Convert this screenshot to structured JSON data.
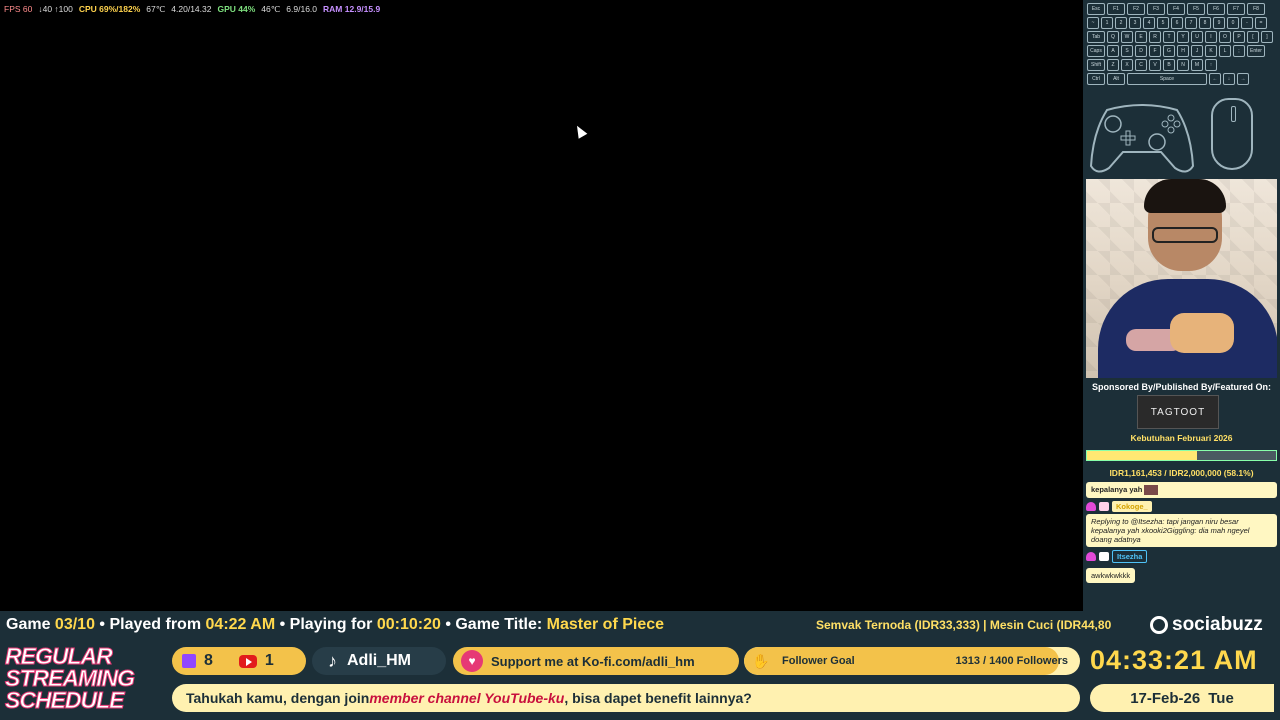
{
  "stats": {
    "fps": "FPS 60",
    "fps_range": "↓40 ↑100",
    "cpu": "CPU 69%/182%",
    "cpu_temp": "67℃",
    "cpu_clock": "4.20/14.32",
    "gpu": "GPU 44%",
    "gpu_temp": "46℃",
    "gpu_mem": "6.9/16.0",
    "ram": "RAM 12.9/15.9"
  },
  "sidebar": {
    "sponsor_title": "Sponsored By/Published By/Featured On:",
    "sponsor_logo": "TAGTOOT",
    "goal_title": "Kebutuhan Februari 2026",
    "goal_progress": 0.581,
    "goal_text": "IDR1,161,453 / IDR2,000,000 (58.1%)",
    "chat": [
      {
        "text": "kepalanya yah"
      },
      {
        "user": "Kokoge_",
        "user_color": "#ffd84d",
        "text": "Replying to @Itsezha: tapi jangan niru besar kepalanya yah xkooki2Giggling:  dia mah ngeyel doang adatnya"
      },
      {
        "user": "Itsezha",
        "user_color": "#4fc3f7",
        "text": "awkwkwkkk"
      }
    ]
  },
  "bottom": {
    "game_label": "Game",
    "game_value": "03/10",
    "played_label": "• Played from",
    "played_value": "04:22 AM",
    "playing_label": "• Playing for",
    "playing_value": "00:10:20",
    "title_label": "• Game Title:",
    "title_value": "Master of Piece",
    "ticker": "Semvak Ternoda (IDR33,333) | Mesin Cuci (IDR44,80",
    "brand": "sociabuzz",
    "schedule": [
      "REGULAR",
      "STREAMING",
      "SCHEDULE"
    ],
    "twitch_count": "8",
    "youtube_count": "1",
    "tiktok_handle": "Adli_HM",
    "kofi_text": "Support me at Ko-fi.com/adli_hm",
    "follower_goal_label": "Follower Goal",
    "follower_goal_value": "1313 / 1400 Followers",
    "follower_progress": 0.938,
    "tip_before": "Tahukah kamu, dengan join ",
    "tip_emph": "member channel YouTube-ku",
    "tip_after": ", bisa dapet benefit lainnya?",
    "clock": "04:33:21  AM",
    "date": "17-Feb-26",
    "day": "Tue"
  },
  "keyboard_rows": [
    [
      "Esc",
      "F1",
      "F2",
      "F3",
      "F4",
      "F5",
      "F6",
      "F7",
      "F8"
    ],
    [
      "~",
      "1",
      "2",
      "3",
      "4",
      "5",
      "6",
      "7",
      "8",
      "9",
      "0",
      "-",
      "="
    ],
    [
      "Tab",
      "Q",
      "W",
      "E",
      "R",
      "T",
      "Y",
      "U",
      "I",
      "O",
      "P",
      "[",
      "]"
    ],
    [
      "Caps",
      "A",
      "S",
      "D",
      "F",
      "G",
      "H",
      "J",
      "K",
      "L",
      ";",
      "Enter"
    ],
    [
      "Shift",
      "Z",
      "X",
      "C",
      "V",
      "B",
      "N",
      "M",
      "↑"
    ],
    [
      "Ctrl",
      "Alt",
      "Space",
      "←",
      "↓",
      "→"
    ]
  ]
}
